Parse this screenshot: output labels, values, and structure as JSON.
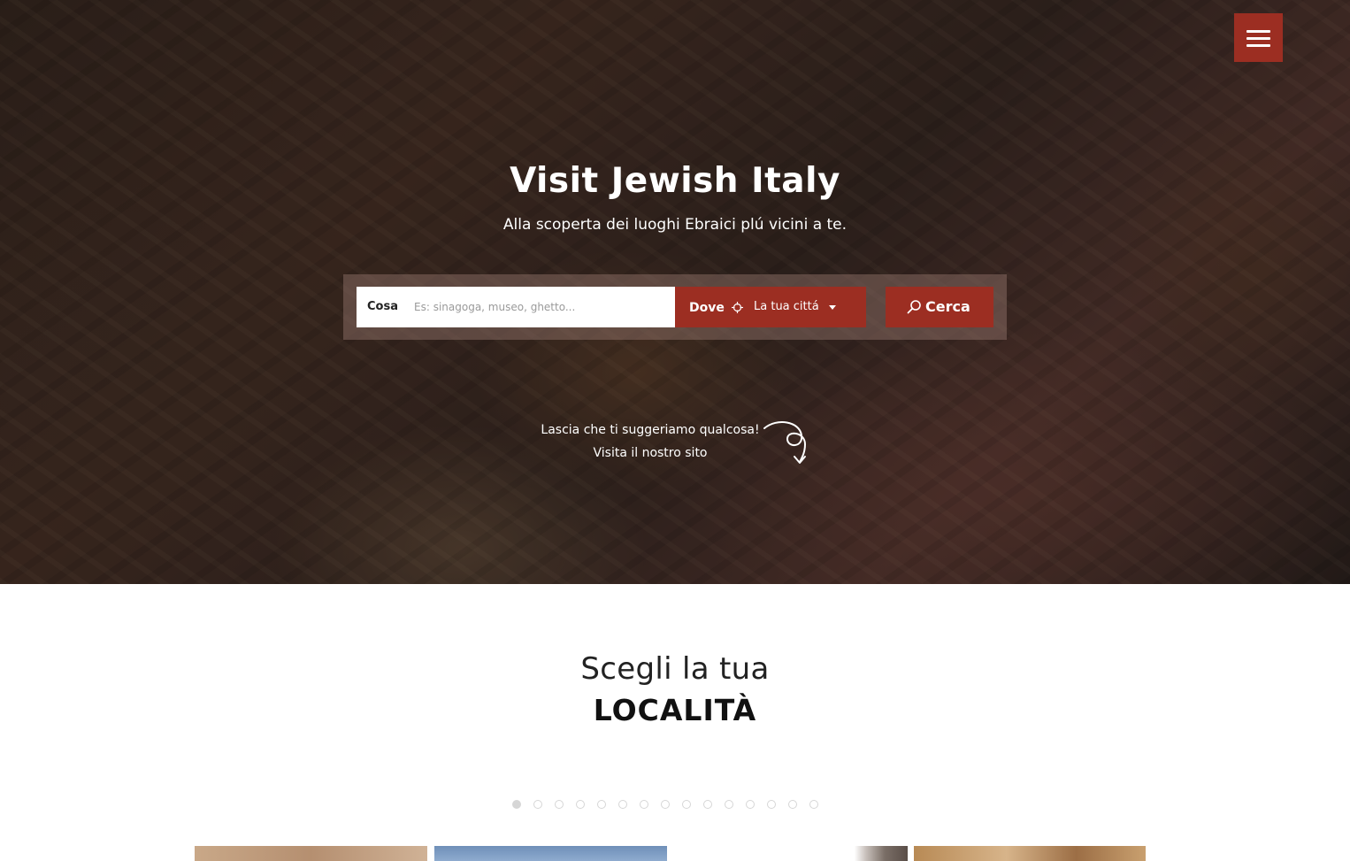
{
  "header": {
    "menu_label": "Menu"
  },
  "hero": {
    "title": "Visit Jewish Italy",
    "subtitle": "Alla scoperta dei luoghi Ebraici plú vicini a te."
  },
  "search": {
    "cosa_label": "Cosa",
    "cosa_placeholder": "Es: sinagoga, museo, ghetto...",
    "cosa_value": "",
    "dove_label": "Dove",
    "city_value": "La tua cittá",
    "submit_label": "Cerca"
  },
  "suggestion": {
    "line1": "Lascia che ti suggeriamo qualcosa!",
    "link": "Visita il nostro sito"
  },
  "localita": {
    "kicker": "Scegli la tua",
    "title": "LOCALITÀ",
    "dot_count": 15,
    "active_dot": 1
  },
  "colors": {
    "accent": "#9c2e22",
    "white": "#ffffff",
    "dot": "#d6d6d6"
  },
  "icons": {
    "menu": "hamburger-icon",
    "locate": "crosshair-icon",
    "dropdown": "caret-down-icon",
    "search": "search-icon",
    "arrow": "swirl-arrow-icon"
  }
}
